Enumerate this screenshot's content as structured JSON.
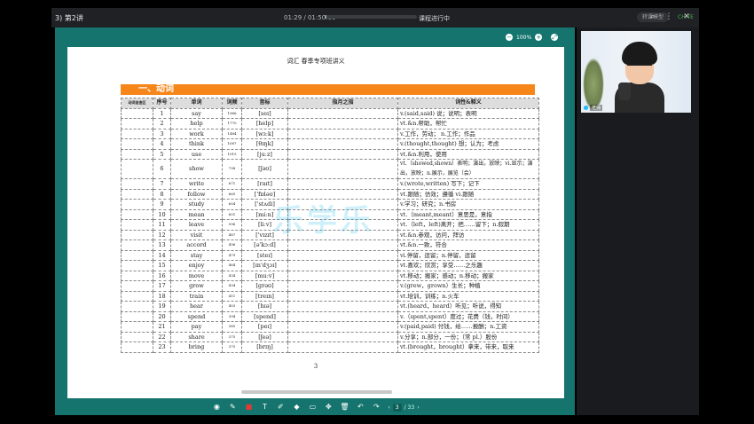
{
  "window": {
    "title": "3) 第2讲",
    "time": "01:29 / 01:50:00",
    "status": "课程进行中",
    "assistant_label": "转课模型",
    "badge": "CH.TE",
    "progress_fraction": 0.02
  },
  "icons": {
    "topbar": [
      "search-icon",
      "more-icon",
      "close-icon"
    ],
    "toolbar": [
      "record-icon",
      "pen-icon",
      "color-icon",
      "text-icon",
      "highlighter-icon",
      "eraser-icon",
      "shape-icon",
      "move-icon",
      "delete-icon",
      "undo-icon",
      "redo-icon",
      "prev-page-icon",
      "next-page-icon"
    ]
  },
  "toolbar_glyphs": [
    "◉",
    "✎",
    "■",
    "T",
    "✐",
    "◆",
    "▭",
    "✥",
    "🗑",
    "↶",
    "↷"
  ],
  "zoom": {
    "minus": "−",
    "value": "100%",
    "plus": "+",
    "fit": "⤢"
  },
  "document": {
    "header": "词汇 春季专项班讲义",
    "section_title": "一、动词",
    "page_number": "3",
    "watermark": "乐学乐",
    "columns": [
      "动词自查区",
      "序号",
      "单词",
      "词频",
      "音标",
      "指月之指",
      "词性&释义"
    ],
    "rows": [
      {
        "n": "1",
        "word": "say",
        "freq": "1966",
        "ipa": "[seɪ]",
        "def": "v.(said,said) 说；说明；表明"
      },
      {
        "n": "2",
        "word": "help",
        "freq": "1770",
        "ipa": "[help]",
        "def": "vt.&n.帮助，帮忙"
      },
      {
        "n": "3",
        "word": "work",
        "freq": "1484",
        "ipa": "[wɜːk]",
        "def": "v.工作，劳动； n.工作；作品"
      },
      {
        "n": "4",
        "word": "think",
        "freq": "1087",
        "ipa": "[θɪŋk]",
        "def": "v.(thought,thought) 想；认为；考虑"
      },
      {
        "n": "5",
        "word": "use",
        "freq": "1015",
        "ipa": "[juːz]",
        "def": "vt.&n.利用，使用"
      },
      {
        "n": "6",
        "word": "show",
        "freq": "798",
        "ipa": "[ʃəʊ]",
        "def": "vt.（showed,shown）表明；演出，放映；vi.显示；演出，放映；n.展示，展览（会）",
        "tall": true
      },
      {
        "n": "7",
        "word": "write",
        "freq": "671",
        "ipa": "[raɪt]",
        "def": "v.(wrote,written) 写下；记下"
      },
      {
        "n": "8",
        "word": "follow",
        "freq": "665",
        "ipa": "['fɒləʊ]",
        "def": "vt.跟随；仿效；遵循 vi.跟随"
      },
      {
        "n": "9",
        "word": "study",
        "freq": "604",
        "ipa": "['stʌdi]",
        "def": "v.学习；研究；n.书房"
      },
      {
        "n": "10",
        "word": "mean",
        "freq": "601",
        "ipa": "[miːn]",
        "def": "vt.（meant,meant）意思是，意指"
      },
      {
        "n": "11",
        "word": "leave",
        "freq": "596",
        "ipa": "[liːv]",
        "def": "vt.（left，left)离开；把……留下；n.假期"
      },
      {
        "n": "12",
        "word": "visit",
        "freq": "487",
        "ipa": "['vɪzɪt]",
        "def": "vt.&n.参观，访问，拜访"
      },
      {
        "n": "13",
        "word": "accord",
        "freq": "496",
        "ipa": "[ə'kɔːd]",
        "def": "vt.&n.一致，符合"
      },
      {
        "n": "14",
        "word": "stay",
        "freq": "479",
        "ipa": "[steɪ]",
        "def": "vi.停留，逗留；n.停留，逗留"
      },
      {
        "n": "15",
        "word": "enjoy",
        "freq": "464",
        "ipa": "[ɪn'dʒɔɪ]",
        "def": "vt.喜欢；欣赏；享受……之乐趣"
      },
      {
        "n": "16",
        "word": "move",
        "freq": "434",
        "ipa": "[muːv]",
        "def": "vt.移动；搬家；感动；n.移动；搬家"
      },
      {
        "n": "17",
        "word": "grow",
        "freq": "434",
        "ipa": "[grəʊ]",
        "def": "v.(grew，grown）生长；种植"
      },
      {
        "n": "18",
        "word": "train",
        "freq": "411",
        "ipa": "[treɪn]",
        "def": "vt.培训，训练；n.火车"
      },
      {
        "n": "19",
        "word": "hear",
        "freq": "403",
        "ipa": "[hɪə]",
        "def": "vt.(heard，heard）听见；听说，得知"
      },
      {
        "n": "20",
        "word": "spend",
        "freq": "394",
        "ipa": "[spend]",
        "def": "v.（spent,spent）度过；花费（钱，时间）"
      },
      {
        "n": "21",
        "word": "pay",
        "freq": "385",
        "ipa": "[peɪ]",
        "def": "v.(paid,paid) 付钱，给……报酬；n.工资"
      },
      {
        "n": "22",
        "word": "share",
        "freq": "375",
        "ipa": "[ʃeə]",
        "def": "v.分享；n.部分，一份；（常 pl.）股份"
      },
      {
        "n": "23",
        "word": "bring",
        "freq": "375",
        "ipa": "[brɪŋ]",
        "def": "vt.(brought，brought）拿来，带来，取来"
      }
    ]
  },
  "pager": {
    "current": "3",
    "total": "/ 33"
  },
  "teacher": {
    "name": "老师"
  },
  "colors": {
    "stage": "#15746e",
    "section": "#f7861a",
    "panel": "#1a1b1e",
    "accent_red": "#e53935"
  }
}
